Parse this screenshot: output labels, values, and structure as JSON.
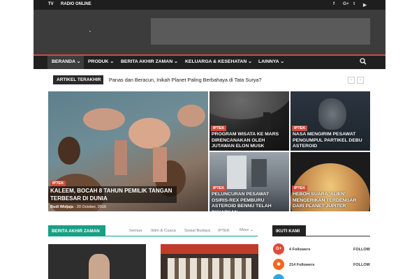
{
  "topbar": {
    "links": [
      "TV",
      "RADIO ONLINE"
    ],
    "social_icons": [
      "facebook-icon",
      "google-plus-icon",
      "twitter-icon",
      "youtube-icon"
    ]
  },
  "nav": {
    "items": [
      "BERANDA",
      "PRODUK",
      "BERITA AKHIR ZAMAN",
      "KELUARGA & KESEHATAN",
      "LAINNYA"
    ],
    "active_index": 0,
    "accent_color": "#d24b3b"
  },
  "ticker": {
    "label": "ARTIKEL TERAKHIR",
    "text": "Panas dan Beracun, Inikah Planet Paling Berbahaya di Tata Surya?"
  },
  "featured": {
    "main": {
      "tag": "IPTEK",
      "title": "KALEEM, BOCAH 8 TAHUN PEMILIK TANGAN TERBESAR DI DUNIA",
      "author": "Budi Widjaja",
      "date": "- 20 October, 2016"
    },
    "tiles": [
      {
        "tag": "IPTEK",
        "title": "PROGRAM WISATA KE MARS DIRENCANAKAN OLEH JUTAWAN ELON MUSK"
      },
      {
        "tag": "IPTEK",
        "title": "NASA MENGIRIM PESAWAT PENGUMPUL PARTIKEL DEBU ASTEROID"
      },
      {
        "tag": "IPTEK",
        "title": "PELUNCURAN PESAWAT OSIRIS-REX PEMBURU ASTEROID BENNU TELAH DISIAPKAN"
      },
      {
        "tag": "IPTEK",
        "title": "HEBOH SUARA 'ALIEN' MENGERIKAN TERDENGAR DARI PLANET JUPITER"
      }
    ]
  },
  "block": {
    "title": "BERITA AKHIR ZAMAN",
    "filters": [
      "Semua",
      "Iklim & Cuaca",
      "Sosial Budaya",
      "IPTEK",
      "More"
    ],
    "accent_color": "#16a085"
  },
  "sidebar": {
    "title": "IKUTI KAMI",
    "social": [
      {
        "icon": "google-plus-icon",
        "count": "4",
        "label": "Followers",
        "button": "FOLLOW",
        "color": "#dd4b39"
      },
      {
        "icon": "rss-icon",
        "count": "214",
        "label": "Followers",
        "button": "FOLLOW",
        "color": "#f26522"
      }
    ]
  }
}
